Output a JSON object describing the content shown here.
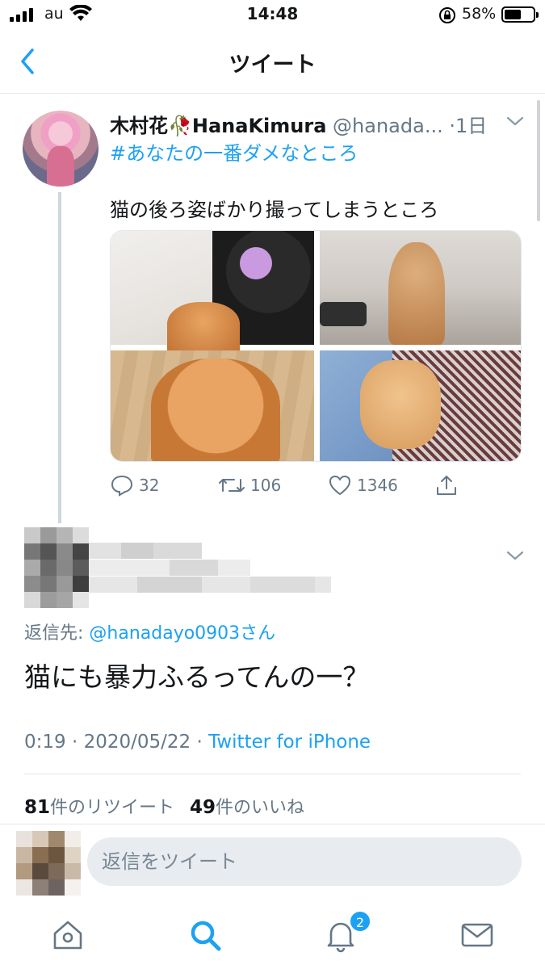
{
  "status_bar": {
    "carrier": "au",
    "time": "14:48",
    "battery_percent": "58%",
    "battery_level": 0.58
  },
  "nav": {
    "title": "ツイート",
    "back_icon": "chevron-left-icon"
  },
  "parent_tweet": {
    "display_name": "木村花🥀HanaKimura",
    "handle": "@hanada...",
    "time_ago": "·1日",
    "hashtag": "#あなたの一番ダメなところ",
    "text": "猫の後ろ姿ばかり撮ってしまうところ",
    "media_count": 4,
    "actions": {
      "replies": "32",
      "retweets": "106",
      "likes": "1346"
    }
  },
  "reply_tweet": {
    "reply_to_prefix": "返信先: ",
    "reply_to_handle": "@hanadayo0903さん",
    "text": "猫にも暴力ふるってんの一？",
    "time": "0:19",
    "date": "2020/05/22",
    "sep": " · ",
    "source": "Twitter for iPhone",
    "retweet_count": "81",
    "retweet_label": "件のリツイート",
    "like_count": "49",
    "like_label": "件のいいね"
  },
  "composer": {
    "placeholder": "返信をツイート"
  },
  "tabbar": {
    "items": [
      "home-icon",
      "search-icon",
      "notifications-icon",
      "messages-icon"
    ],
    "notification_badge": "2"
  },
  "colors": {
    "accent": "#1da1f2",
    "secondary_text": "#657786",
    "divider": "#e1e8ed"
  }
}
